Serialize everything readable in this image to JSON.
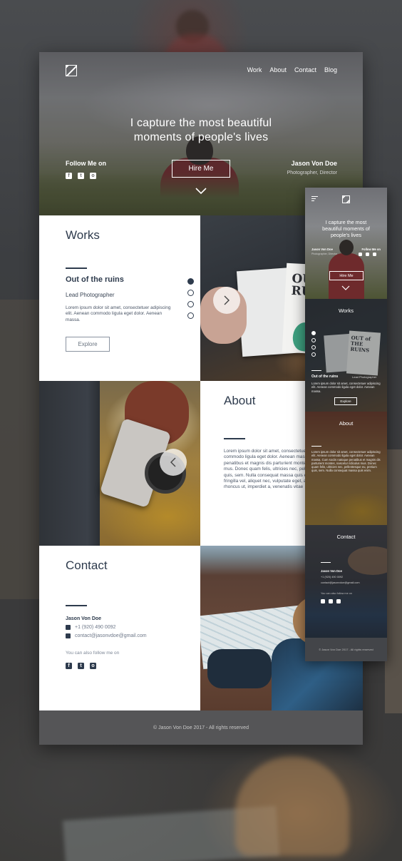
{
  "desktop": {
    "nav": [
      "Work",
      "About",
      "Contact",
      "Blog"
    ],
    "hero": {
      "headline_line1": "I capture the most beautiful",
      "headline_line2": "moments of people's lives",
      "follow_label": "Follow Me on",
      "hire_button": "Hire Me",
      "name": "Jason Von Doe",
      "role": "Photographer, Director"
    },
    "works": {
      "title": "Works",
      "item_title": "Out of the ruins",
      "item_role": "Lead Photographer",
      "item_text": "Lorem ipsum dolor sit amet, consectetuer adipiscing elit. Aenean commodo ligula eget dolor. Aenean massa.",
      "explore_button": "Explore",
      "book_title": "OUT\nRU",
      "slides_count": 4,
      "active_slide": 1
    },
    "about": {
      "title": "About",
      "text": "Lorem ipsum dolor sit amet, consectetuer adipiscing elit. Aenean commodo ligula eget dolor. Aenean massa. Cum sociis natoque penatibus et magnis dis parturient montes, nascetur ridiculus mus. Donec quam felis, ultricies nec, pellentesque eu, pretium quis, sem. Nulla consequat massa quis enim. Donec pede justo, fringilla vel, aliquet nec, vulputate eget, arcu. In enim justo, rhoncus ut, imperdiet a, venenatis vitae"
    },
    "contact": {
      "title": "Contact",
      "name": "Jason Von Doe",
      "phone": "+1 (920) 490 0092",
      "email": "contact@jasonvdoe@gmail.com",
      "follow_text": "You can also follow me on"
    },
    "footer": "© Jason Von Doe 2017 - All rights reserved"
  },
  "mobile": {
    "headline": "I capture the most beautiful moments of people's lives",
    "name": "Jason Von Doe",
    "role": "Photographer, Director",
    "follow_label": "Follow Me on",
    "hire_button": "Hire Me",
    "works_title": "Works",
    "item_title": "Out of the ruins",
    "item_role": "Lead Photographer",
    "item_text": "Lorem ipsum dolor sit amet, consectetuer adipiscing elit. Aenean commodo ligula eget dolor. Aenean massa.",
    "book_title": "OUT of THE RUINS",
    "explore_button": "Explore",
    "about_title": "About",
    "about_text": "Lorem ipsum dolor sit amet, consectetuer adipiscing elit. Aenean commodo ligula eget dolor. Aenean massa. Cum sociis natoque penatibus et magnis dis parturient montes, nascetur ridiculus mus. Donec quam felis, ultricies nec, pellentesque eu, pretium quis, sem. Nulla consequat massa quis enim.",
    "contact_title": "Contact",
    "contact_name": "Jason Von Doe",
    "phone": "+1 (920) 490 0092",
    "email": "contact@jasonvdoe@gmail.com",
    "follow_text": "You can also follow me on",
    "footer": "© Jason Von Doe 2017 - All rights reserved"
  },
  "icons": {
    "facebook": "f",
    "twitter": "t",
    "instagram": "o"
  },
  "colors": {
    "accent": "#2e3b4d",
    "footer": "#555557"
  }
}
